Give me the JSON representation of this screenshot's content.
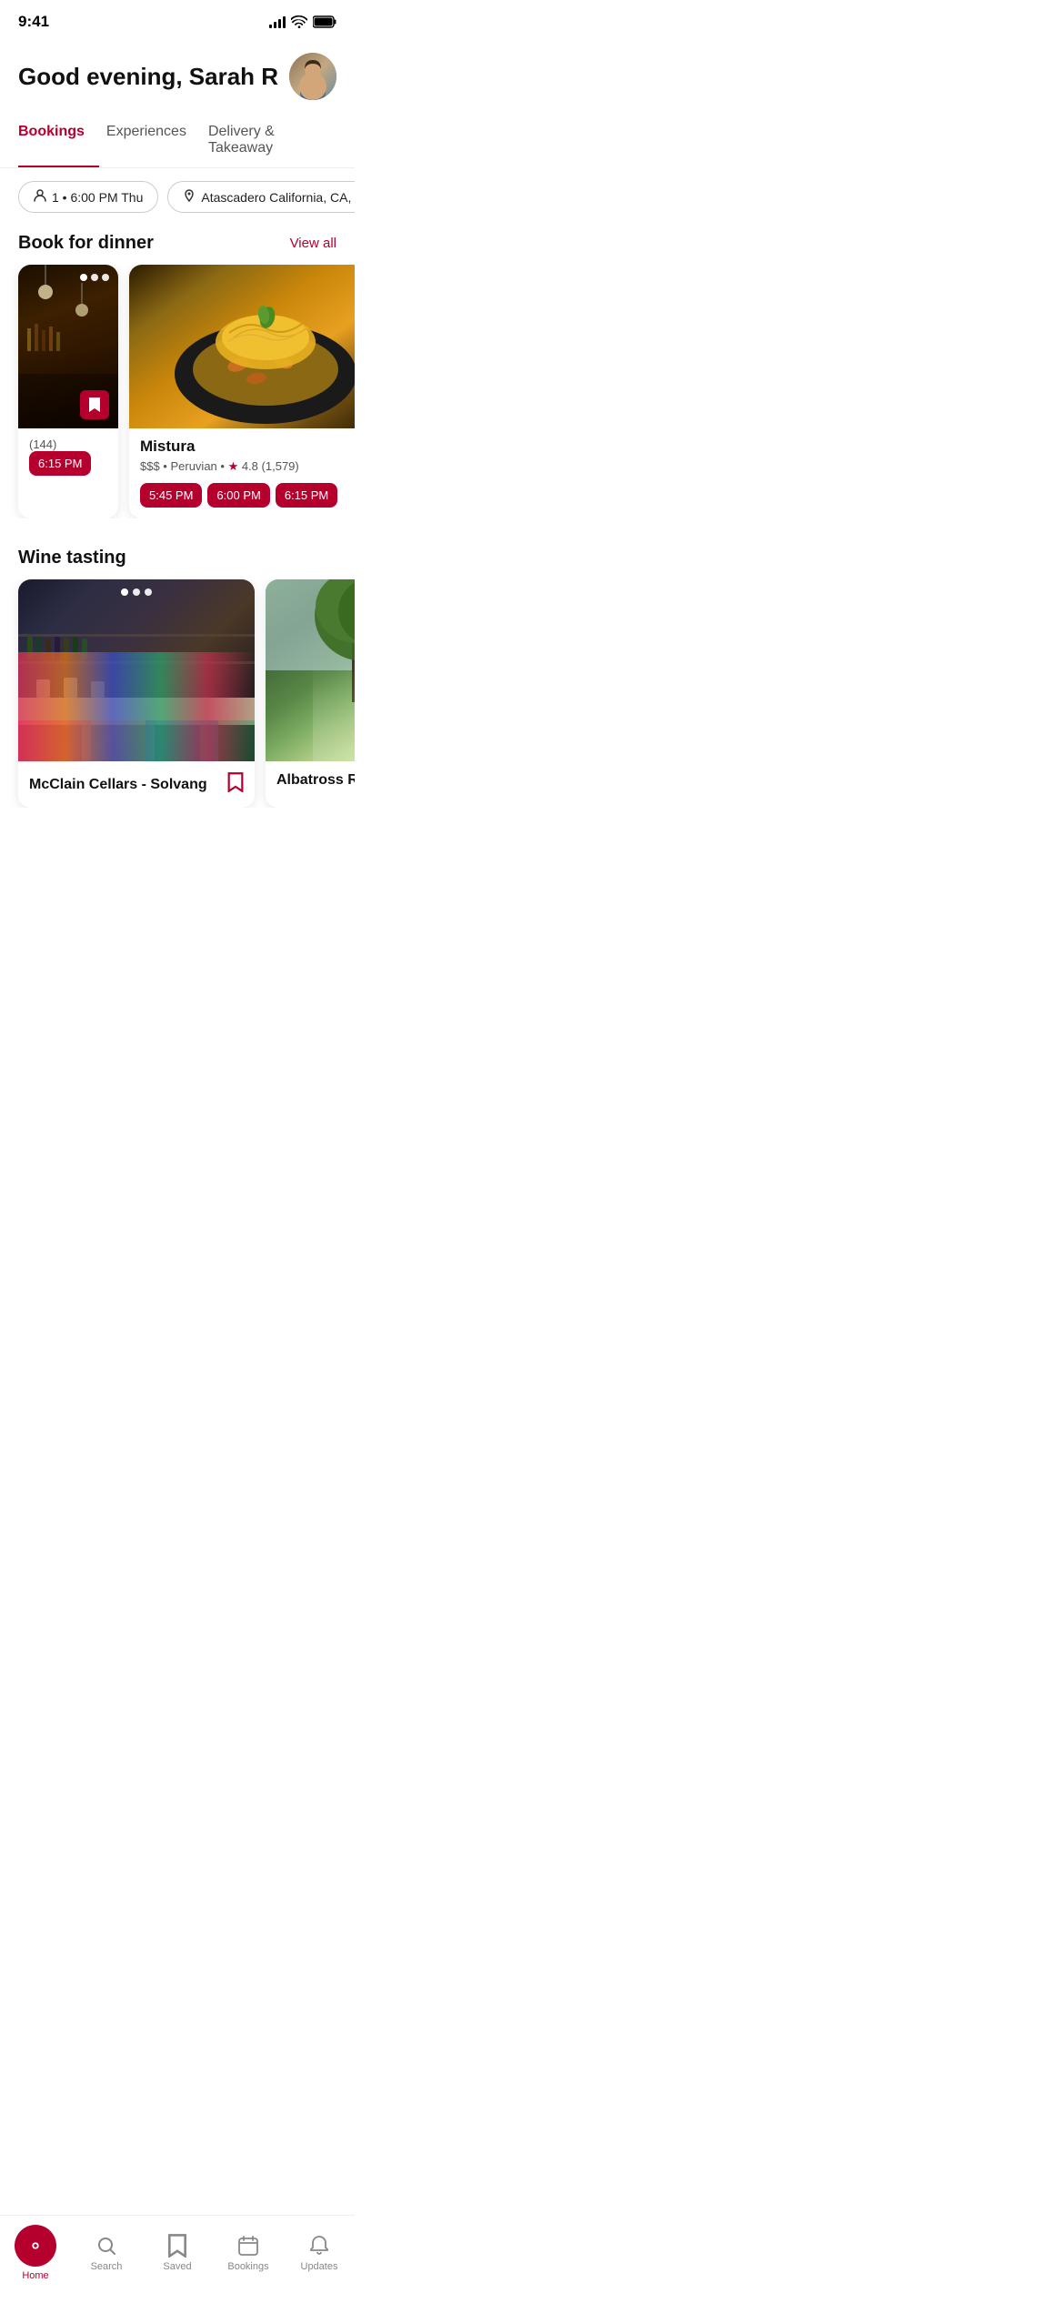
{
  "statusBar": {
    "time": "9:41"
  },
  "header": {
    "greeting": "Good evening, Sarah R"
  },
  "tabs": [
    {
      "label": "Bookings",
      "active": true
    },
    {
      "label": "Experiences",
      "active": false
    },
    {
      "label": "Delivery & Takeaway",
      "active": false
    }
  ],
  "filters": [
    {
      "icon": "👤",
      "label": "1 • 6:00 PM Thu"
    },
    {
      "icon": "📍",
      "label": "Atascadero California, CA, United St..."
    }
  ],
  "bookForDinner": {
    "title": "Book for dinner",
    "viewAll": "View all",
    "cards": [
      {
        "name": "...",
        "rating": "",
        "meta": "(144)",
        "type": "bar",
        "times": [
          "6:15 PM"
        ]
      },
      {
        "name": "Mistura",
        "rating": "4.8",
        "ratingCount": "1,579",
        "meta": "$$$ • Peruvian •",
        "type": "food",
        "times": [
          "5:45 PM",
          "6:00 PM",
          "6:15 PM"
        ]
      }
    ]
  },
  "wineTasting": {
    "title": "Wine tasting",
    "cards": [
      {
        "name": "McClain Cellars - Solvang",
        "type": "cellar"
      },
      {
        "name": "Albatross Rid...",
        "type": "house"
      }
    ]
  },
  "bottomNav": [
    {
      "label": "Home",
      "icon": "home",
      "active": true
    },
    {
      "label": "Search",
      "icon": "search",
      "active": false
    },
    {
      "label": "Saved",
      "icon": "bookmark",
      "active": false
    },
    {
      "label": "Bookings",
      "icon": "calendar",
      "active": false
    },
    {
      "label": "Updates",
      "icon": "bell",
      "active": false
    }
  ]
}
